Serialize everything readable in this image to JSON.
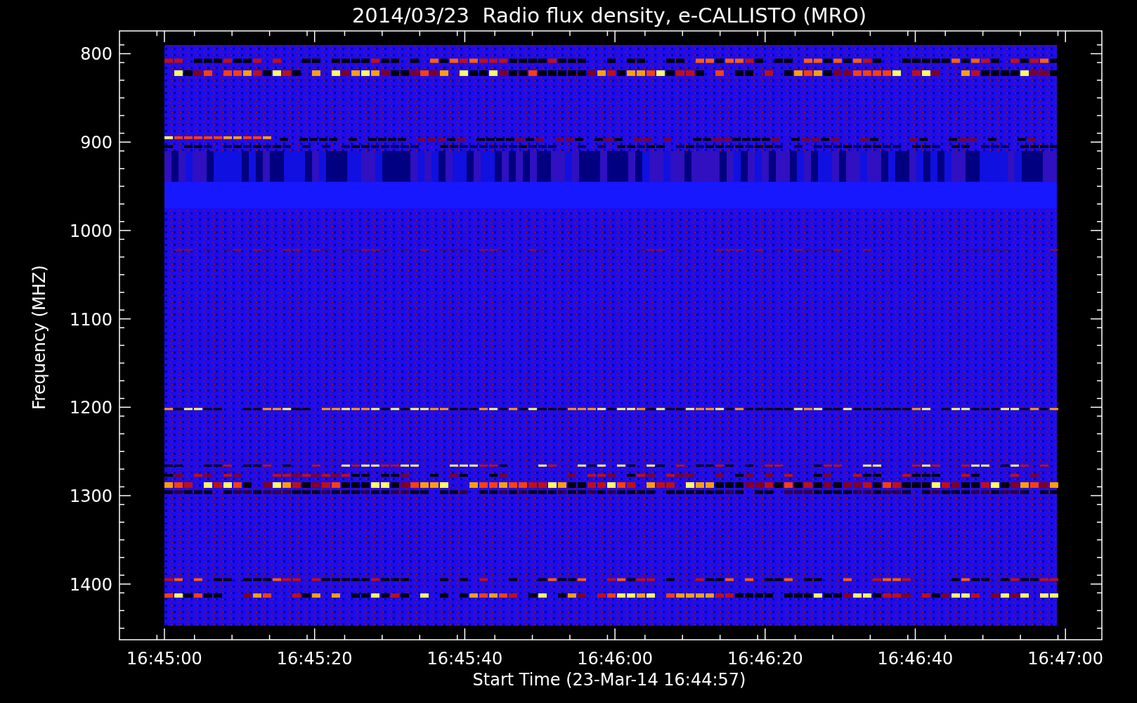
{
  "title": "2014/03/23  Radio flux density, e-CALLISTO (MRO)",
  "y_axis": {
    "label": "Frequency (MHZ)",
    "ticks": [
      "800",
      "900",
      "1000",
      "1100",
      "1200",
      "1300",
      "1400"
    ]
  },
  "x_axis": {
    "label": "Start Time (23-Mar-14 16:44:57)",
    "ticks": [
      "16:45:00",
      "16:45:20",
      "16:45:40",
      "16:46:00",
      "16:46:20",
      "16:46:40",
      "16:47:00"
    ]
  }
}
